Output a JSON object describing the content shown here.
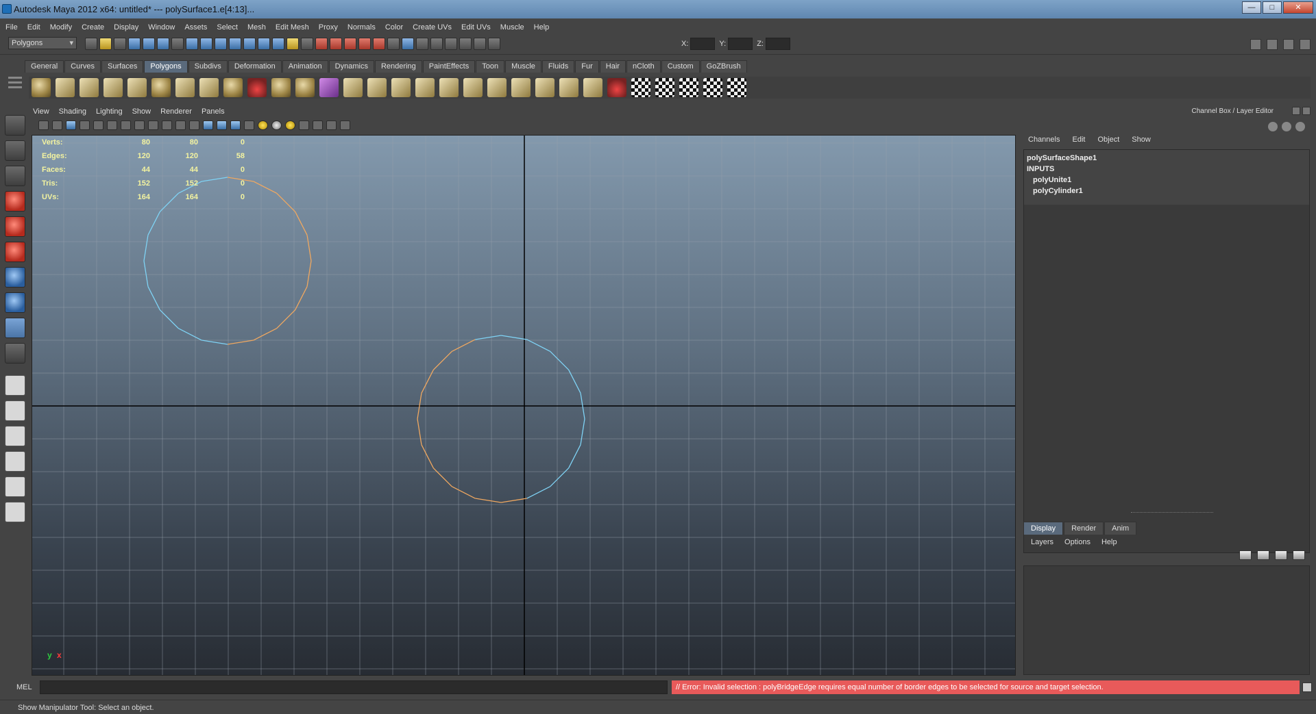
{
  "window": {
    "title": "Autodesk Maya 2012 x64: untitled*   ---   polySurface1.e[4:13]...",
    "minimize": "—",
    "maximize": "□",
    "close": "✕"
  },
  "menubar": [
    "File",
    "Edit",
    "Modify",
    "Create",
    "Display",
    "Window",
    "Assets",
    "Select",
    "Mesh",
    "Edit Mesh",
    "Proxy",
    "Normals",
    "Color",
    "Create UVs",
    "Edit UVs",
    "Muscle",
    "Help"
  ],
  "statusline": {
    "mode": "Polygons",
    "x_label": "X:",
    "y_label": "Y:",
    "z_label": "Z:"
  },
  "shelf": {
    "tabs": [
      "General",
      "Curves",
      "Surfaces",
      "Polygons",
      "Subdivs",
      "Deformation",
      "Animation",
      "Dynamics",
      "Rendering",
      "PaintEffects",
      "Toon",
      "Muscle",
      "Fluids",
      "Fur",
      "Hair",
      "nCloth",
      "Custom",
      "GoZBrush"
    ],
    "active_tab": "Polygons"
  },
  "panel": {
    "menu": [
      "View",
      "Shading",
      "Lighting",
      "Show",
      "Renderer",
      "Panels"
    ]
  },
  "hud": {
    "rows": [
      {
        "label": "Verts:",
        "a": "80",
        "b": "80",
        "c": "0"
      },
      {
        "label": "Edges:",
        "a": "120",
        "b": "120",
        "c": "58"
      },
      {
        "label": "Faces:",
        "a": "44",
        "b": "44",
        "c": "0"
      },
      {
        "label": "Tris:",
        "a": "152",
        "b": "152",
        "c": "0"
      },
      {
        "label": "UVs:",
        "a": "164",
        "b": "164",
        "c": "0"
      }
    ]
  },
  "axis": {
    "y": "y",
    "x": "x"
  },
  "channel_box": {
    "header": "Channel Box / Layer Editor",
    "menu": [
      "Channels",
      "Edit",
      "Object",
      "Show"
    ],
    "shape": "polySurfaceShape1",
    "inputs_label": "INPUTS",
    "inputs": [
      "polyUnite1",
      "polyCylinder1"
    ]
  },
  "layer_editor": {
    "tabs": [
      "Display",
      "Render",
      "Anim"
    ],
    "active_tab": "Display",
    "menu": [
      "Layers",
      "Options",
      "Help"
    ]
  },
  "command_line": {
    "label": "MEL",
    "result": "// Error: Invalid selection : polyBridgeEdge requires equal number of border edges to be selected for source and target selection."
  },
  "help_line": "Show Manipulator Tool: Select an object.",
  "colors": {
    "error_bg": "#e85a5a",
    "highlight_edge": "#f0a860",
    "wire_blue": "#7fd3f5",
    "hud_text": "#f3f3a0"
  }
}
